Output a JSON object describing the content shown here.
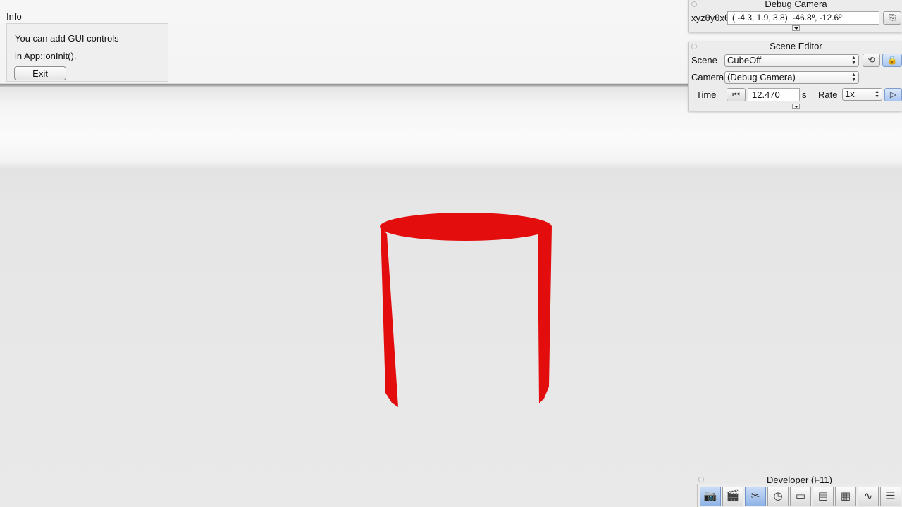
{
  "info": {
    "title": "Info",
    "line1": "You can add GUI controls",
    "line2": "in App::onInit().",
    "exit_label": "Exit"
  },
  "debug_camera": {
    "title": "Debug Camera",
    "xyz_label": "xyzθyθxθz",
    "value": "( -4.3,   1.9,   3.8), -46.8º, -12.6º",
    "copy_icon": "clipboard-icon"
  },
  "scene_editor": {
    "title": "Scene Editor",
    "scene_label": "Scene",
    "scene_value": "CubeOff",
    "camera_label": "Camera",
    "camera_value": "(Debug Camera)",
    "time_label": "Time",
    "time_value": "12.470",
    "time_unit": "s",
    "rate_label": "Rate",
    "rate_value": "1x"
  },
  "developer": {
    "title": "Developer (F11)",
    "buttons": [
      {
        "icon": "camera-icon",
        "glyph": "📷",
        "active": true
      },
      {
        "icon": "clapperboard-icon",
        "glyph": "🎬",
        "active": false
      },
      {
        "icon": "tools-icon",
        "glyph": "✂",
        "active": true
      },
      {
        "icon": "clock-icon",
        "glyph": "◷",
        "active": false
      },
      {
        "icon": "note-icon",
        "glyph": "▭",
        "active": false
      },
      {
        "icon": "console-icon",
        "glyph": "▤",
        "active": false
      },
      {
        "icon": "scene-tree-icon",
        "glyph": "▦",
        "active": false
      },
      {
        "icon": "profiler-icon",
        "glyph": "∿",
        "active": false
      },
      {
        "icon": "log-icon",
        "glyph": "☰",
        "active": false
      }
    ]
  },
  "scene": {
    "object_color": "#e30d0d"
  }
}
